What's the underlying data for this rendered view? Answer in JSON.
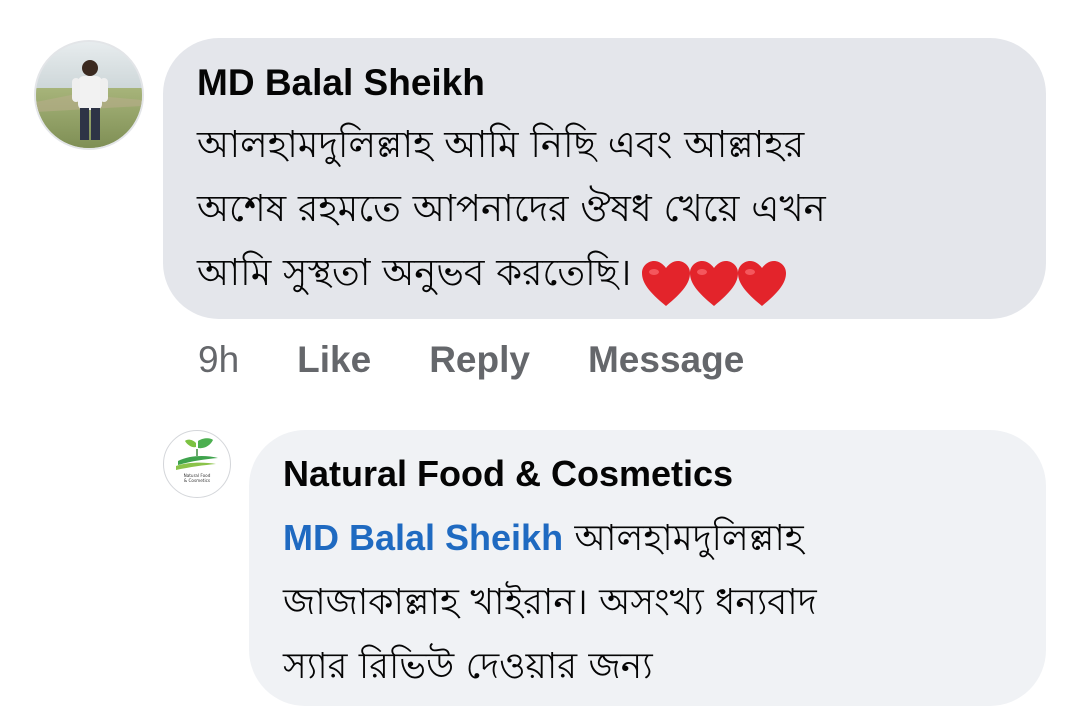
{
  "comment": {
    "author": "MD Balal Sheikh",
    "lines": [
      "আলহামদুলিল্লাহ আমি নিছি এবং আল্লাহর",
      "অশেষ রহমতে আপনাদের ঔষধ খেয়ে এখন",
      "আমি সুস্থতা অনুভব করতেছি।"
    ],
    "emoji": [
      "heart-icon",
      "heart-icon",
      "heart-icon"
    ],
    "heart_color": "#e3242b"
  },
  "actions": {
    "time": "9h",
    "like": "Like",
    "reply": "Reply",
    "message": "Message"
  },
  "reply": {
    "author": "Natural Food & Cosmetics",
    "mention": "MD Balal Sheikh",
    "line1_rest": "আলহামদুলিল্লাহ",
    "line2": "জাজাকাল্লাহ খাইরান। অসংখ্য ধন্যবাদ",
    "line3": "স্যার রিভিউ দেওয়ার জন্য",
    "avatar_logo_text": "Natural Food & Cosmetics"
  },
  "colors": {
    "main_bubble": "#e4e6eb",
    "reply_bubble": "#f0f2f5",
    "mention": "#1f6ac1",
    "meta_text": "#65676b"
  }
}
